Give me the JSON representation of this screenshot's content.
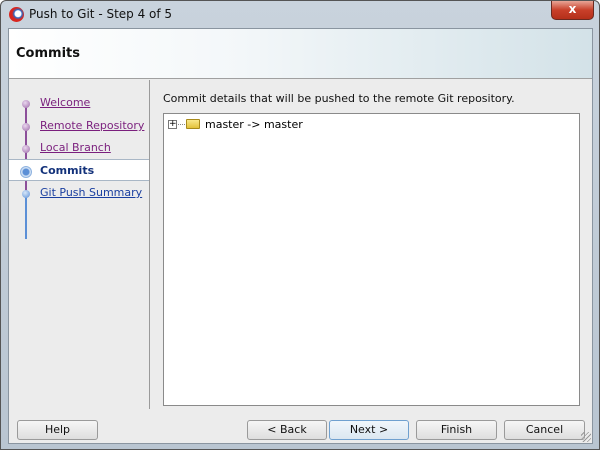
{
  "window": {
    "title": "Push to Git - Step 4 of 5",
    "close_label": "x"
  },
  "header": {
    "title": "Commits"
  },
  "steps": [
    {
      "label": "Welcome",
      "state": "done"
    },
    {
      "label": "Remote Repository",
      "state": "done"
    },
    {
      "label": "Local Branch",
      "state": "done"
    },
    {
      "label": "Commits",
      "state": "current"
    },
    {
      "label": "Git Push Summary",
      "state": "pending"
    }
  ],
  "main": {
    "description": "Commit details that will be pushed to the remote Git repository.",
    "tree": [
      {
        "label": "master -> master",
        "expand": "+"
      }
    ]
  },
  "buttons": {
    "help": "Help",
    "back": "< Back",
    "next": "Next >",
    "finish": "Finish",
    "cancel": "Cancel"
  }
}
